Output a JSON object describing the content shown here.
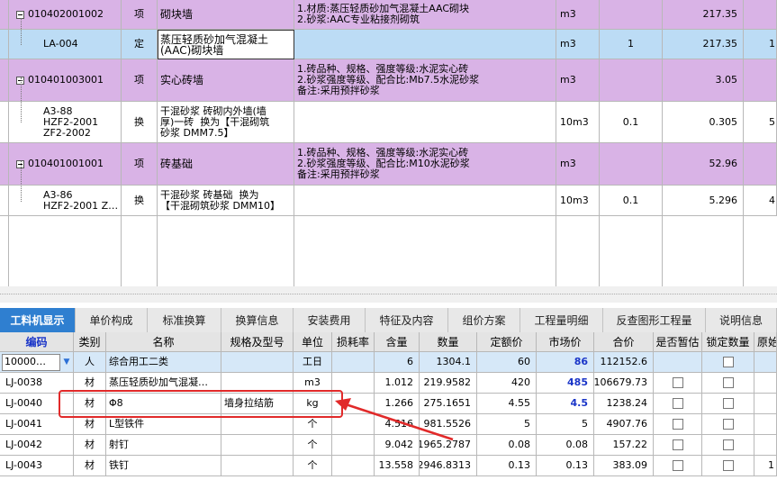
{
  "top_rows": [
    {
      "code": "010402001002",
      "type": "项",
      "name": "砌块墙",
      "feature": "1.材质:蒸压轻质砂加气混凝土AAC砌块\n2.砂浆:AAC专业粘接剂砌筑",
      "unit": "m3",
      "qty_expr": "",
      "qty": "217.35",
      "extra": "",
      "kind": "parent"
    },
    {
      "code": "LA-004",
      "type": "定",
      "name": "蒸压轻质砂加气混凝土\n(AAC)砌块墙",
      "feature": "",
      "unit": "m3",
      "qty_expr": "1",
      "qty": "217.35",
      "extra": "1",
      "kind": "selected"
    },
    {
      "code": "010401003001",
      "type": "项",
      "name": "实心砖墙",
      "feature": "1.砖品种、规格、强度等级:水泥实心砖\n2.砂浆强度等级、配合比:Mb7.5水泥砂浆\n备注:采用预拌砂浆",
      "unit": "m3",
      "qty_expr": "",
      "qty": "3.05",
      "extra": "",
      "kind": "parent"
    },
    {
      "code": "A3-88\nHZF2-2001\nZF2-2002",
      "type": "换",
      "name": "干混砂浆 砖砌内外墙(墙\n厚)一砖  换为【干混砌筑\n砂浆 DMM7.5】",
      "feature": "",
      "unit": "10m3",
      "qty_expr": "0.1",
      "qty": "0.305",
      "extra": "5",
      "kind": "child"
    },
    {
      "code": "010401001001",
      "type": "项",
      "name": "砖基础",
      "feature": "1.砖品种、规格、强度等级:水泥实心砖\n2.砂浆强度等级、配合比:M10水泥砂浆\n备注:采用预拌砂浆",
      "unit": "m3",
      "qty_expr": "",
      "qty": "52.96",
      "extra": "",
      "kind": "parent"
    },
    {
      "code": "A3-86\nHZF2-2001 Z…",
      "type": "换",
      "name": "干混砂浆 砖基础  换为\n【干混砌筑砂浆 DMM10】",
      "feature": "",
      "unit": "10m3",
      "qty_expr": "0.1",
      "qty": "5.296",
      "extra": "4",
      "kind": "child"
    }
  ],
  "tabs": [
    "工料机显示",
    "单价构成",
    "标准换算",
    "换算信息",
    "安装费用",
    "特征及内容",
    "组价方案",
    "工程量明细",
    "反查图形工程量",
    "说明信息"
  ],
  "active_tab": 0,
  "columns": [
    "编码",
    "类别",
    "名称",
    "规格及型号",
    "单位",
    "损耗率",
    "含量",
    "数量",
    "定额价",
    "市场价",
    "合价",
    "是否暂估",
    "锁定数量",
    "原始"
  ],
  "bottom_rows": [
    {
      "code": "10000…",
      "cat": "人",
      "name": "综合用工二类",
      "spec": "",
      "unit": "工日",
      "loss": "",
      "content": "6",
      "qty": "1304.1",
      "quota": "60",
      "market": "86",
      "market_blue": true,
      "total": "112152.6",
      "estimate": false,
      "lock": true,
      "orig": "",
      "selected": true
    },
    {
      "code": "LJ-0038",
      "cat": "材",
      "name": "蒸压轻质砂加气混凝…",
      "spec": "",
      "unit": "m3",
      "loss": "",
      "content": "1.012",
      "qty": "219.9582",
      "quota": "420",
      "market": "485",
      "market_blue": true,
      "total": "106679.73",
      "estimate": true,
      "lock": true,
      "orig": "",
      "selected": false
    },
    {
      "code": "LJ-0040",
      "cat": "材",
      "name": "Φ8",
      "spec": "墙身拉结筋",
      "unit": "kg",
      "loss": "",
      "content": "1.266",
      "qty": "275.1651",
      "quota": "4.55",
      "market": "4.5",
      "market_blue": true,
      "total": "1238.24",
      "estimate": true,
      "lock": true,
      "orig": "",
      "selected": false
    },
    {
      "code": "LJ-0041",
      "cat": "材",
      "name": "L型铁件",
      "spec": "",
      "unit": "个",
      "loss": "",
      "content": "4.516",
      "qty": "981.5526",
      "quota": "5",
      "market": "5",
      "market_blue": false,
      "total": "4907.76",
      "estimate": true,
      "lock": true,
      "orig": "",
      "selected": false
    },
    {
      "code": "LJ-0042",
      "cat": "材",
      "name": "射钉",
      "spec": "",
      "unit": "个",
      "loss": "",
      "content": "9.042",
      "qty": "1965.2787",
      "quota": "0.08",
      "market": "0.08",
      "market_blue": false,
      "total": "157.22",
      "estimate": true,
      "lock": true,
      "orig": "",
      "selected": false
    },
    {
      "code": "LJ-0043",
      "cat": "材",
      "name": "铁钉",
      "spec": "",
      "unit": "个",
      "loss": "",
      "content": "13.558",
      "qty": "2946.8313",
      "quota": "0.13",
      "market": "0.13",
      "market_blue": false,
      "total": "383.09",
      "estimate": true,
      "lock": true,
      "orig": "1",
      "selected": false
    }
  ],
  "colors": {
    "purple": "#d9b3e6",
    "selected": "#bcdcf5",
    "tab_active": "#2f7fd0",
    "annotation": "#e12a2a",
    "market_blue": "#1a35c8"
  }
}
